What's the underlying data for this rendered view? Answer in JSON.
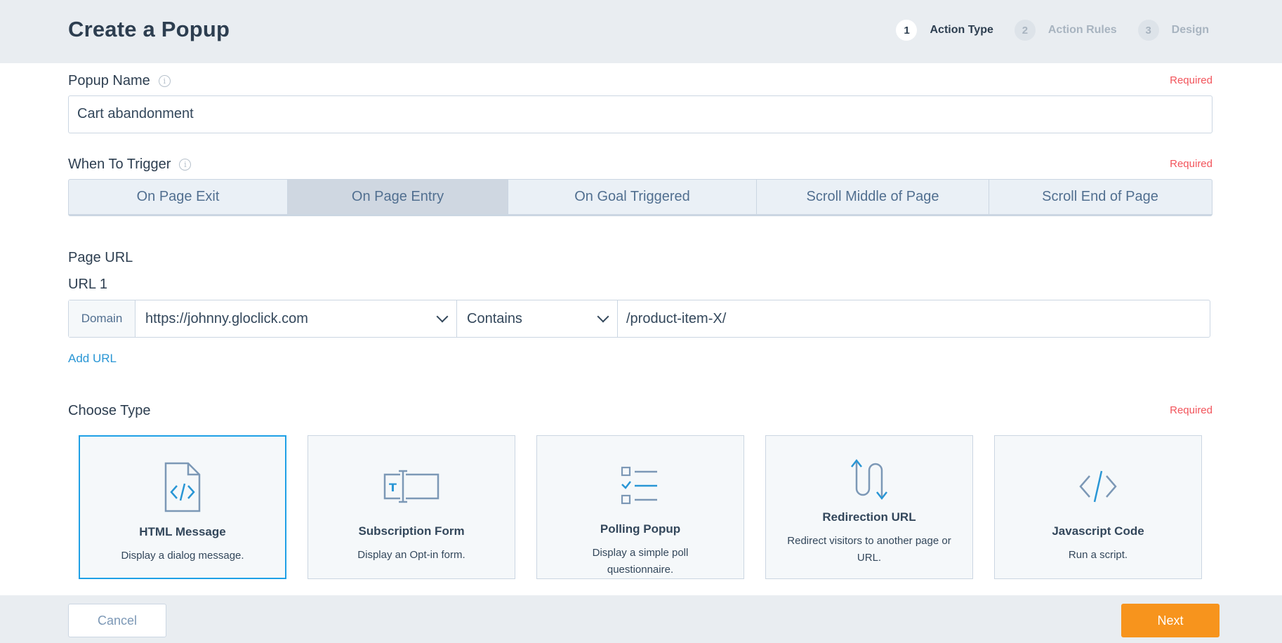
{
  "header": {
    "title": "Create a Popup",
    "steps": [
      {
        "num": "1",
        "label": "Action Type",
        "active": true
      },
      {
        "num": "2",
        "label": "Action Rules",
        "active": false
      },
      {
        "num": "3",
        "label": "Design",
        "active": false
      }
    ]
  },
  "popup_name": {
    "label": "Popup Name",
    "required": "Required",
    "value": "Cart abandonment"
  },
  "trigger": {
    "label": "When To Trigger",
    "required": "Required",
    "options": [
      "On Page Exit",
      "On Page Entry",
      "On Goal Triggered",
      "Scroll Middle of Page",
      "Scroll End of Page"
    ],
    "selected": "On Page Entry"
  },
  "page_url": {
    "section_label": "Page URL",
    "url_label": "URL 1",
    "prefix": "Domain",
    "domain": "https://johnny.gloclick.com",
    "match": "Contains",
    "path": "/product-item-X/",
    "add_url": "Add URL"
  },
  "choose_type": {
    "label": "Choose Type",
    "required": "Required",
    "selected": "HTML Message",
    "cards": [
      {
        "icon": "html-file-icon",
        "title": "HTML Message",
        "desc": "Display a dialog message."
      },
      {
        "icon": "form-field-icon",
        "title": "Subscription Form",
        "desc": "Display an Opt-in form."
      },
      {
        "icon": "checklist-icon",
        "title": "Polling Popup",
        "desc": "Display a simple poll questionnaire."
      },
      {
        "icon": "redirect-arrows-icon",
        "title": "Redirection URL",
        "desc": "Redirect visitors to another page or URL."
      },
      {
        "icon": "code-brackets-icon",
        "title": "Javascript Code",
        "desc": "Run a script."
      }
    ]
  },
  "footer": {
    "cancel": "Cancel",
    "next": "Next"
  },
  "colors": {
    "accent_blue": "#1fa0e6",
    "required_red": "#f2545b",
    "next_orange": "#f7941d",
    "icon_gray": "#7c98b6"
  }
}
